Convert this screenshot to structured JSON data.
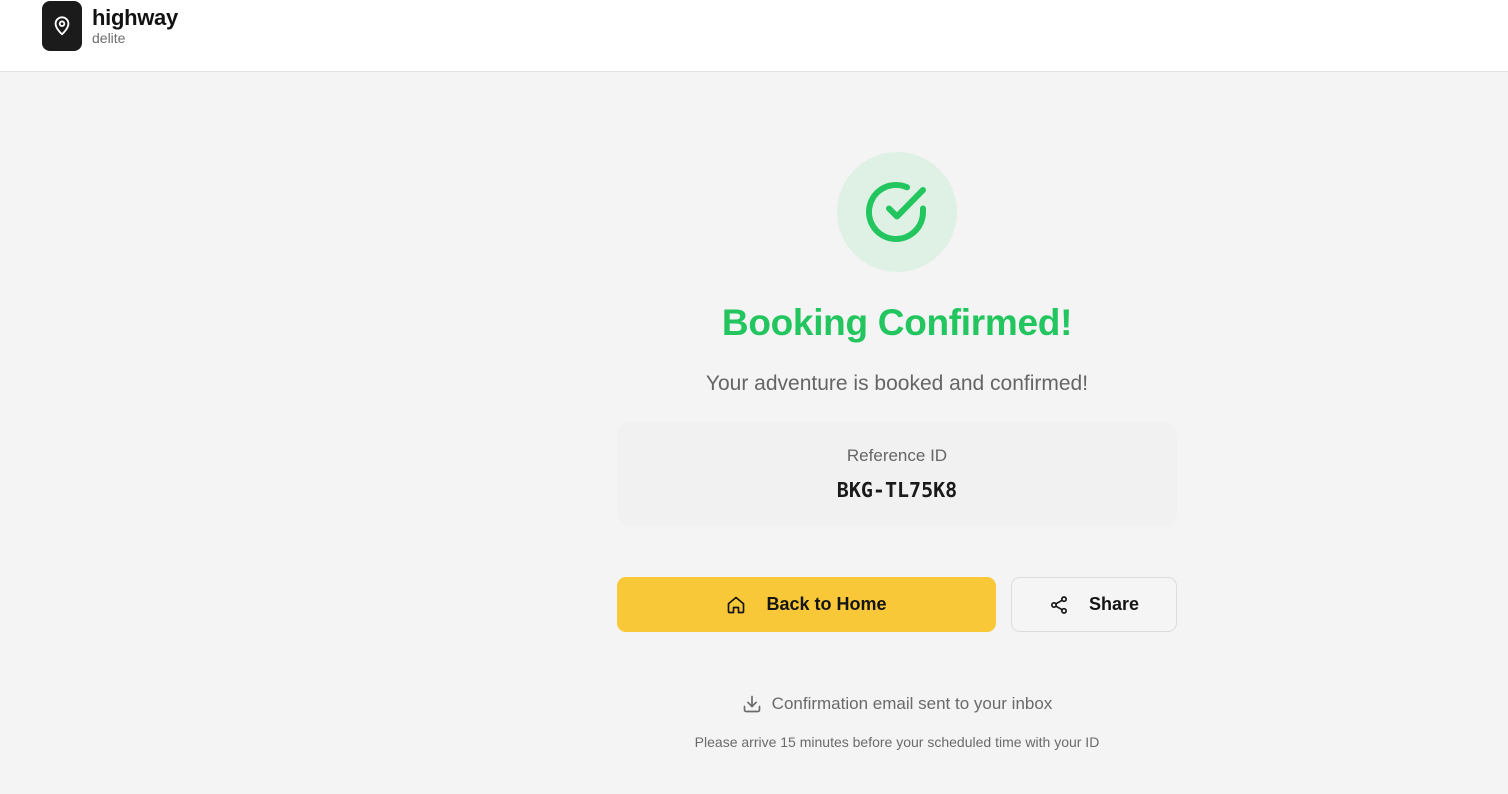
{
  "header": {
    "brand_name": "highway",
    "brand_sub": "delite",
    "logo_icon": "map-pin-icon"
  },
  "confirmation": {
    "status_icon": "check-circle-icon",
    "title": "Booking Confirmed!",
    "subtitle": "Your adventure is booked and confirmed!",
    "reference_label": "Reference ID",
    "reference_id": "BKG-TL75K8"
  },
  "actions": {
    "home_label": "Back to Home",
    "home_icon": "home-icon",
    "share_label": "Share",
    "share_icon": "share-icon"
  },
  "footer": {
    "email_icon": "download-icon",
    "email_note": "Confirmation email sent to your inbox",
    "arrival_note": "Please arrive 15 minutes before your scheduled time with your ID"
  },
  "colors": {
    "accent_green": "#22c55e",
    "button_yellow": "#f8c838",
    "background": "#f4f4f4"
  }
}
